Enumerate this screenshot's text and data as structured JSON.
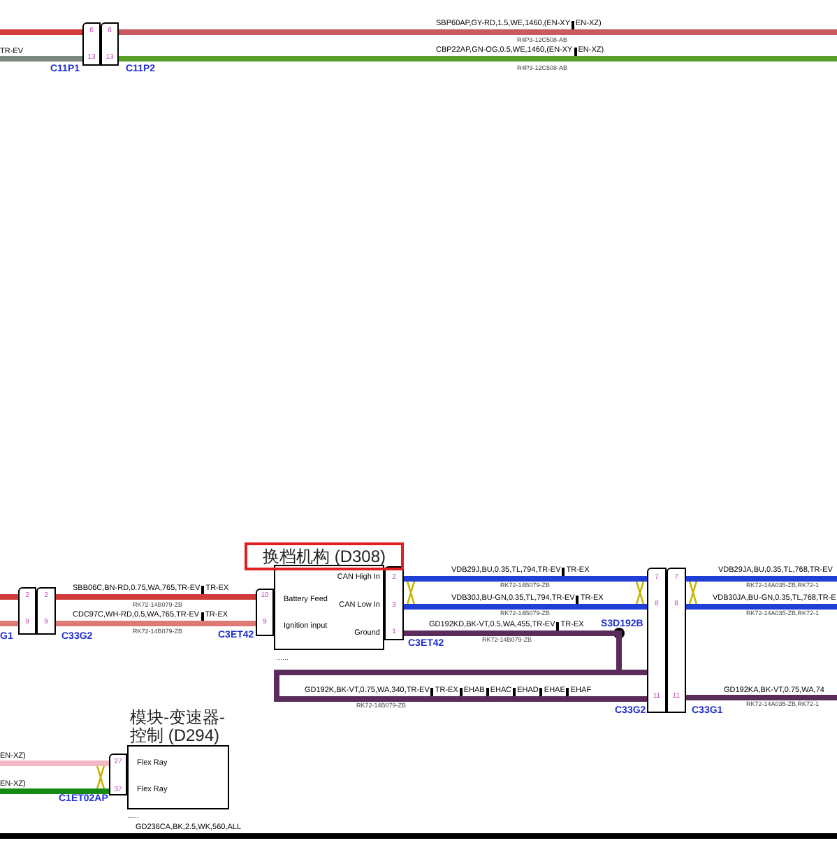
{
  "wires": [
    {
      "color": "#d23b3b"
    },
    {
      "color": "#7a8a80",
      "label_parts": [
        "TR-EV"
      ]
    },
    {
      "color": "#c85a60",
      "label_parts": [
        "SBP60AP,GY-RD,1.5,WE,1460,(EN-XY",
        "EN-XZ)"
      ],
      "reference": "R4P3-12C508-AB"
    },
    {
      "color": "#5aa02a",
      "label_parts": [
        "CBP22AP,GN-OG,0.5,WE,1460,(EN-XY",
        "EN-XZ)"
      ],
      "reference": "R4P3-12C508-AB"
    },
    {
      "color": "#d23b3b"
    },
    {
      "color": "#e07878"
    },
    {
      "color": "#d23b3b",
      "label_parts": [
        "SBB06C,BN-RD,0.75,WA,765,TR-EV",
        "TR-EX"
      ],
      "reference": "RK72-14B079-ZB"
    },
    {
      "color": "#e07878",
      "label_parts": [
        "CDC97C,WH-RD,0.5,WA,765,TR-EV",
        "TR-EX"
      ],
      "reference": "RK72-14B079-ZB"
    },
    {
      "color": "#1f3fd6",
      "label_parts": [
        "VDB29J,BU,0.35,TL,794,TR-EV",
        "TR-EX"
      ],
      "reference": "RK72-14B079-ZB"
    },
    {
      "color": "#1f3fd6",
      "label_parts": [
        "VDB30J,BU-GN,0.35,TL,794,TR-EV",
        "TR-EX"
      ],
      "reference": "RK72-14B079-ZB"
    },
    {
      "color": "#5b2c5b",
      "label_parts": [
        "GD192KD,BK-VT,0.5,WA,455,TR-EV",
        "TR-EX"
      ],
      "reference": "RK72-14B079-ZB"
    },
    {
      "color": "#5b2c5b",
      "label_parts": [
        "GD192K,BK-VT,0.75,WA,340,TR-EV",
        "TR-EX",
        "EHAB",
        "EHAC",
        "EHAD",
        "EHAE",
        "EHAF"
      ],
      "reference": "RK72-14B079-ZB"
    },
    {
      "color": "#1f3fd6",
      "label_parts": [
        "VDB29JA,BU,0.35,TL,768,TR-EV"
      ],
      "reference": "RK72-14A035-ZB,RK72-1"
    },
    {
      "color": "#1f3fd6",
      "label_parts": [
        "VDB30JA,BU-GN,0.35,TL,768,TR-E"
      ],
      "reference": "RK72-14A035-ZB,RK72-1"
    },
    {
      "color": "#5b2c5b",
      "label_parts": [
        "GD192KA,BK-VT,0.75,WA,74"
      ],
      "reference": "RK72-14A035-ZB,RK72-1"
    },
    {
      "color": "#f2b8c4",
      "label_parts": [
        "EN-XZ)"
      ]
    },
    {
      "color": "#138a13",
      "label_parts": [
        "EN-XZ)"
      ]
    },
    {
      "color": "#000000",
      "label_parts": [
        "GD236CA,BK,2.5,WK,560,ALL"
      ]
    }
  ],
  "connectors": [
    {
      "label": "C11P1",
      "pins": [
        "6",
        "13"
      ]
    },
    {
      "label": "C11P2",
      "pins": [
        "6",
        "13"
      ]
    },
    {
      "label": "G1",
      "pins": [
        "2",
        "9"
      ]
    },
    {
      "label": "C33G2",
      "pins": [
        "2",
        "9"
      ]
    },
    {
      "label": "C3ET42",
      "pins": [
        "10",
        "9"
      ]
    },
    {
      "label": "C3ET42",
      "pins": [
        "2",
        "3",
        "1"
      ]
    },
    {
      "label": "C33G2",
      "pins": [
        "7",
        "8",
        "11"
      ]
    },
    {
      "label": "C33G1",
      "pins": [
        "7",
        "8",
        "11"
      ]
    },
    {
      "label": "C1ET02AP",
      "pins": [
        "27",
        "37"
      ]
    }
  ],
  "splice": {
    "label": "S3D192B"
  },
  "modules": [
    {
      "title_lines": [
        "换档机构 (D308)"
      ],
      "highlighted": true,
      "pins": [
        "CAN High In",
        "CAN Low In",
        "Ground",
        "Battery Feed",
        "Ignition input"
      ],
      "footnote": "......"
    },
    {
      "title_lines": [
        "模块-变速器-",
        "控制 (D294)"
      ],
      "highlighted": false,
      "pins": [
        "Flex Ray",
        "Flex Ray"
      ],
      "footnote": "......"
    }
  ]
}
